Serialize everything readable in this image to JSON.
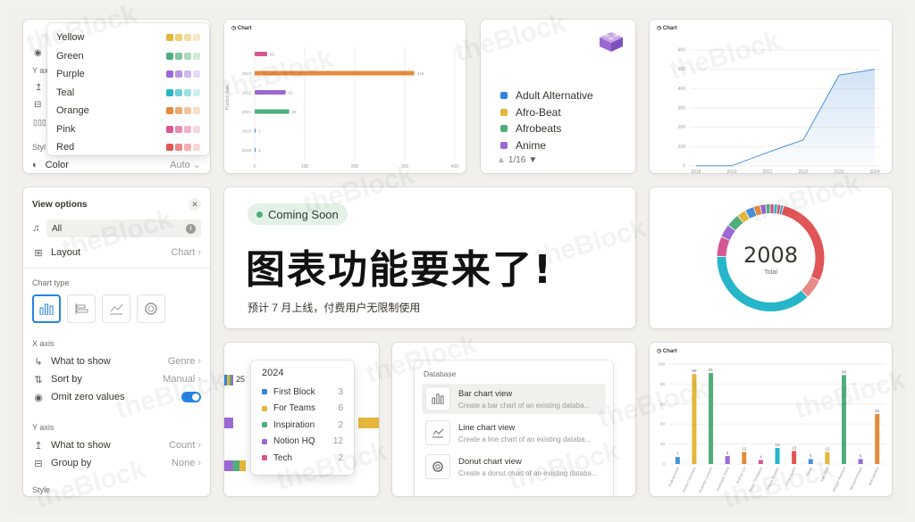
{
  "colors_menu": {
    "items": [
      {
        "label": "Yellow",
        "swatches": [
          "#e4b63a",
          "#efcf79",
          "#f4dea3",
          "#f8e9c7"
        ]
      },
      {
        "label": "Green",
        "swatches": [
          "#4fae7c",
          "#82c6a0",
          "#abd9be",
          "#d1eadb"
        ]
      },
      {
        "label": "Purple",
        "swatches": [
          "#9b68d4",
          "#b896e2",
          "#d0b9ec",
          "#e6d9f5"
        ]
      },
      {
        "label": "Teal",
        "swatches": [
          "#26b5c9",
          "#6dcfdc",
          "#9fe0e8",
          "#cdeff3"
        ]
      },
      {
        "label": "Orange",
        "swatches": [
          "#e58a3c",
          "#eeab70",
          "#f3c79d",
          "#f8e0c8"
        ]
      },
      {
        "label": "Pink",
        "swatches": [
          "#d75792",
          "#e68cb5",
          "#f0b4cf",
          "#f7d7e6"
        ]
      },
      {
        "label": "Red",
        "swatches": [
          "#e05555",
          "#ea8787",
          "#f2b1b1",
          "#f8d6d6"
        ]
      }
    ],
    "behind": {
      "style_label": "Styl",
      "y_label": "Y ax",
      "color_label": "Color",
      "color_value": "Auto"
    }
  },
  "bar_card": {
    "title": "Chart",
    "ylabel": "Publish Date",
    "categories": [
      "",
      "2023",
      "2022",
      "2021",
      "2019",
      "2018"
    ],
    "values": [
      25,
      319,
      62,
      69,
      1,
      1
    ],
    "value_labels": [
      "25",
      "319",
      "62",
      "69",
      "1",
      "1"
    ],
    "colors": [
      "#d75792",
      "#e58a3c",
      "#9b68d4",
      "#4fae7c",
      "#4a90d9",
      "#4a90d9"
    ],
    "xticks": [
      "0",
      "100",
      "200",
      "300",
      "400"
    ]
  },
  "legend_card": {
    "items": [
      {
        "label": "Adult Alternative",
        "color": "#2e86de"
      },
      {
        "label": "Afro-Beat",
        "color": "#e4b63a"
      },
      {
        "label": "Afrobeats",
        "color": "#4fae7c"
      },
      {
        "label": "Anime",
        "color": "#9b68d4"
      }
    ],
    "pager": "1/16",
    "up_arrow": "▲",
    "down_arrow": "▼"
  },
  "line_card": {
    "title": "Chart",
    "x": [
      "2018",
      "2019",
      "2021",
      "2022",
      "2023",
      "2024"
    ],
    "y": [
      1,
      1,
      70,
      135,
      470,
      500
    ],
    "yticks": [
      "0",
      "100",
      "200",
      "300",
      "400",
      "500",
      "600"
    ],
    "color": "#4a90d9"
  },
  "view_options": {
    "title": "View options",
    "source": "All",
    "layout_label": "Layout",
    "layout_value": "Chart",
    "chart_type_label": "Chart type",
    "x_axis_label": "X axis",
    "what_to_show": "What to show",
    "what_to_show_value": "Genre",
    "sort_by": "Sort by",
    "sort_by_value": "Manual",
    "omit_zero": "Omit zero values",
    "y_axis_label": "Y axis",
    "y_what_to_show": "What to show",
    "y_what_to_show_value": "Count",
    "group_by": "Group by",
    "group_by_value": "None",
    "style_label": "Style"
  },
  "announcement": {
    "badge": "Coming Soon",
    "headline": "图表功能要来了!",
    "subline": "预计 7 月上线，付费用户无限制使用"
  },
  "donut_card": {
    "total": "2008",
    "total_label": "Total",
    "segments": [
      {
        "value": 420,
        "color": "#e05555"
      },
      {
        "value": 90,
        "color": "#e88a8a"
      },
      {
        "value": 560,
        "color": "#26b5c9"
      },
      {
        "value": 90,
        "color": "#d75792"
      },
      {
        "value": 60,
        "color": "#9b68d4"
      },
      {
        "value": 60,
        "color": "#4fae7c"
      },
      {
        "value": 40,
        "color": "#e4b63a"
      },
      {
        "value": 40,
        "color": "#4a90d9"
      },
      {
        "value": 30,
        "color": "#e58a3c"
      },
      {
        "value": 25,
        "color": "#9b68d4"
      },
      {
        "value": 20,
        "color": "#4fae7c"
      },
      {
        "value": 18,
        "color": "#d75792"
      },
      {
        "value": 15,
        "color": "#26b5c9"
      },
      {
        "value": 15,
        "color": "#e05555"
      },
      {
        "value": 12,
        "color": "#4a90d9"
      }
    ]
  },
  "tooltip_card": {
    "year": "2024",
    "partial_value": "25",
    "rows": [
      {
        "label": "First Block",
        "value": "3",
        "color": "#2e86de"
      },
      {
        "label": "For Teams",
        "value": "6",
        "color": "#e4b63a"
      },
      {
        "label": "Inspiration",
        "value": "2",
        "color": "#4fae7c"
      },
      {
        "label": "Notion HQ",
        "value": "12",
        "color": "#9b68d4"
      },
      {
        "label": "Tech",
        "value": "2",
        "color": "#d75792"
      }
    ]
  },
  "database_menu": {
    "header": "Database",
    "items": [
      {
        "title": "Bar chart view",
        "desc": "Create a bar chart of an existing databa..."
      },
      {
        "title": "Line chart view",
        "desc": "Create a line chart of an existing databa..."
      },
      {
        "title": "Donut chart view",
        "desc": "Create a donut chart of an existing databa..."
      }
    ]
  },
  "column_card": {
    "title": "Chart",
    "yticks": [
      "0",
      "20",
      "40",
      "60",
      "80",
      "100"
    ],
    "values": [
      7,
      90,
      91,
      8,
      12,
      4,
      16,
      13,
      5,
      12,
      89,
      5,
      50
    ],
    "value_labels": [
      "7",
      "90",
      "91",
      "8",
      "12",
      "4",
      "16",
      "13",
      "5",
      "12",
      "89",
      "5",
      "50"
    ],
    "colors": [
      "#4a90d9",
      "#e4b63a",
      "#4fae7c",
      "#9b68d4",
      "#e58a3c",
      "#d75792",
      "#26b5c9",
      "#e05555",
      "#4a90d9",
      "#e4b63a",
      "#4fae7c",
      "#9b68d4",
      "#e58a3c"
    ],
    "categories": [
      "Andrew Keith",
      "Ariana Chambers",
      "Anabelle Connors",
      "Anastasia Zimny",
      "Andrea Lim",
      "Bruce Thompson",
      "Cassie Kozman",
      "Chris Kaden",
      "Derek",
      "Ivan Zhao",
      "Maggie Rowland",
      "Michael Kovacs",
      "Nate Martins"
    ]
  },
  "watermark": {
    "text": "theBlock"
  }
}
